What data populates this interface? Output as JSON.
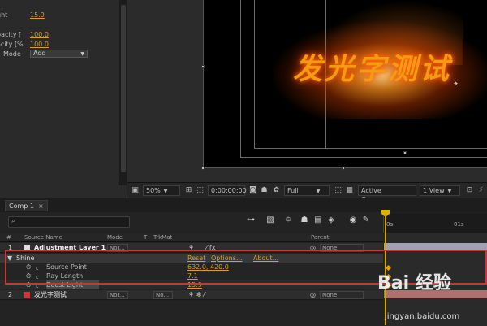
{
  "effect_controls": {
    "props": [
      {
        "label": "ght",
        "value": "15.9"
      },
      {
        "label": "pacity [",
        "value": "100.0"
      },
      {
        "label": "acity [%",
        "value": "100.0"
      }
    ],
    "mode": {
      "label": "Mode",
      "value": "Add"
    }
  },
  "comp_viewer": {
    "text": "发光字测试"
  },
  "viewer_toolbar": {
    "zoom": "50%",
    "timecode": "0:00:00:00",
    "resolution": "Full",
    "camera": "Active Camera",
    "views": "1 View"
  },
  "timeline": {
    "tab_label": "Comp 1",
    "tab_close": "×",
    "ruler": {
      "start": "0s",
      "mark": "01s"
    },
    "columns": {
      "num": "#",
      "source": "Source Name",
      "mode": "Mode",
      "t": "T",
      "trkmat": "TrkMat",
      "parent": "Parent"
    },
    "layers": [
      {
        "num": "1",
        "name": "Adjustment Layer 1",
        "mode": "Nor...",
        "parent": "None"
      },
      {
        "num": "2",
        "name": "发光字测试",
        "mode": "Nor...",
        "trkmat": "No...",
        "parent": "None"
      }
    ],
    "effect": {
      "name": "Shine",
      "reset": "Reset",
      "options": "Options...",
      "about": "About...",
      "props": [
        {
          "label": "Source Point",
          "value": "632.0, 420.0"
        },
        {
          "label": "Ray Length",
          "value": "7.1"
        },
        {
          "label": "Boost Light",
          "value": "15.9"
        }
      ]
    }
  },
  "watermark": {
    "text": "Bai 经验",
    "url": "jingyan.baidu.com"
  },
  "colors": {
    "accent": "#d6a032",
    "highlight": "#c13a3a",
    "glow_text": "#f49a14"
  }
}
